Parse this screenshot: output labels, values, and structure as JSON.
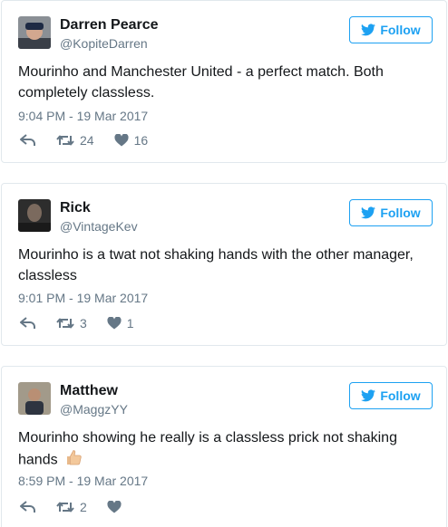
{
  "colors": {
    "accent": "#1da1f2",
    "muted": "#657786",
    "text": "#14171a",
    "border": "#e1e8ed"
  },
  "follow_label": "Follow",
  "tweets": [
    {
      "name": "Darren Pearce",
      "handle": "@KopiteDarren",
      "text": "Mourinho and Manchester United - a perfect match. Both completely classless.",
      "time": "9:04 PM - 19 Mar 2017",
      "retweets": "24",
      "likes": "16"
    },
    {
      "name": "Rick",
      "handle": "@VintageKev",
      "text": "Mourinho is a twat not shaking hands with the other manager, classless",
      "time": "9:01 PM - 19 Mar 2017",
      "retweets": "3",
      "likes": "1"
    },
    {
      "name": "Matthew",
      "handle": "@MaggzYY",
      "text": "Mourinho showing he really is a classless prick not shaking hands",
      "emoji": "thumbs-up-icon",
      "time": "8:59 PM - 19 Mar 2017",
      "retweets": "2",
      "likes": ""
    }
  ]
}
